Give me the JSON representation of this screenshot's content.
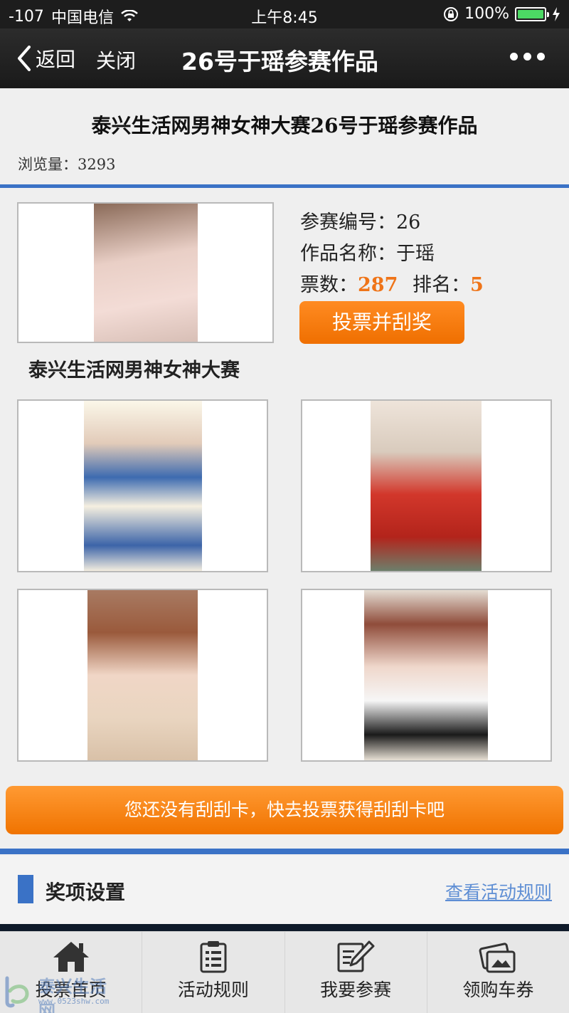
{
  "status_bar": {
    "signal": "-107",
    "carrier": "中国电信",
    "time": "上午8:45",
    "battery": "100%"
  },
  "nav": {
    "back_label": "返回",
    "close_label": "关闭",
    "title": "26号于瑶参赛作品"
  },
  "page": {
    "heading": "泰兴生活网男神女神大赛26号于瑶参赛作品",
    "views": "浏览量：3293"
  },
  "entry": {
    "number_label": "参赛编号：",
    "number_value": "26",
    "name_label": "作品名称：",
    "name_value": "于瑶",
    "votes_label": "票数：",
    "votes_value": "287",
    "rank_label": "排名：",
    "rank_value": "5",
    "vote_button": "投票并刮奖",
    "contest_name": "泰兴生活网男神女神大赛"
  },
  "scratch_banner": "您还没有刮刮卡，快去投票获得刮刮卡吧",
  "prize": {
    "title": "奖项设置",
    "rules_link": "查看活动规则"
  },
  "tabs": [
    {
      "label": "投票首页",
      "icon": "home-icon"
    },
    {
      "label": "活动规则",
      "icon": "clipboard-icon"
    },
    {
      "label": "我要参赛",
      "icon": "edit-icon"
    },
    {
      "label": "领购车券",
      "icon": "coupon-icon"
    }
  ],
  "watermark": {
    "text": "泰兴生活网",
    "url": "www.0523shw.com"
  },
  "colors": {
    "accent_blue": "#3a72c6",
    "orange": "#ef7418"
  }
}
